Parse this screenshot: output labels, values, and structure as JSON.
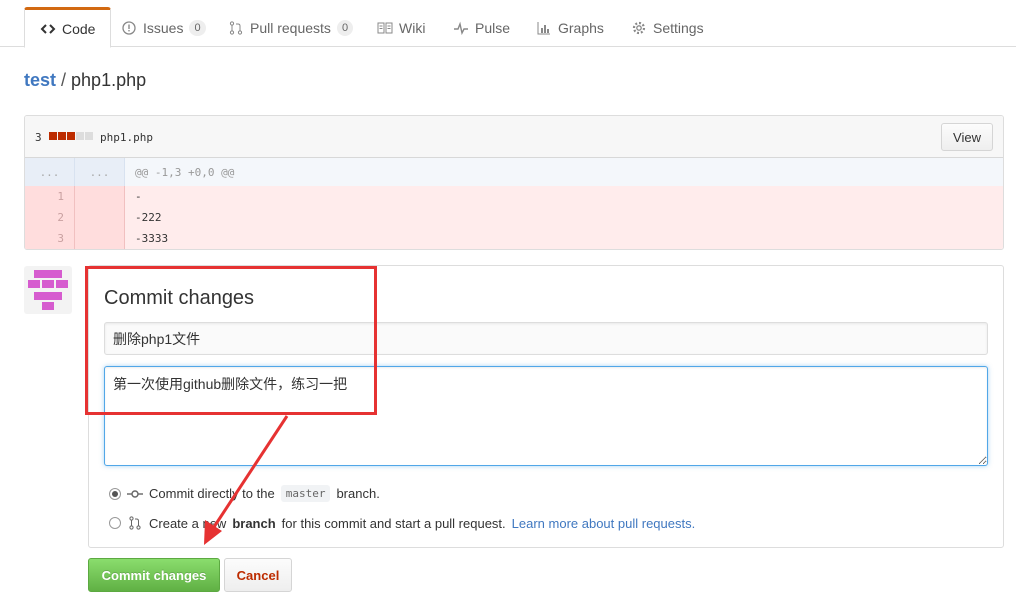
{
  "tabs": [
    {
      "label": "Code",
      "icon": "code-icon"
    },
    {
      "label": "Issues",
      "count": "0",
      "icon": "issue-icon"
    },
    {
      "label": "Pull requests",
      "count": "0",
      "icon": "pull-request-icon"
    },
    {
      "label": "Wiki",
      "icon": "book-icon"
    },
    {
      "label": "Pulse",
      "icon": "pulse-icon"
    },
    {
      "label": "Graphs",
      "icon": "graph-icon"
    },
    {
      "label": "Settings",
      "icon": "gear-icon"
    }
  ],
  "breadcrumb": {
    "repo": "test",
    "separator": "/",
    "file": "php1.php"
  },
  "file": {
    "diffstat": "3",
    "diffstat_colors": [
      "#bd2c00",
      "#bd2c00",
      "#bd2c00",
      "#dddddd",
      "#dddddd"
    ],
    "name": "php1.php",
    "view_label": "View",
    "hunk": {
      "ln_left": "...",
      "ln_right": "...",
      "text": "@@ -1,3 +0,0 @@"
    },
    "lines": [
      {
        "ln": "1",
        "text": "-"
      },
      {
        "ln": "2",
        "text": "-222"
      },
      {
        "ln": "3",
        "text": "-3333"
      }
    ]
  },
  "commit": {
    "title": "Commit changes",
    "summary_value": "删除php1文件",
    "description_value": "第一次使用github删除文件，练习一把",
    "option_direct": {
      "prefix": "Commit directly to the",
      "branch": "master",
      "suffix": "branch."
    },
    "option_new": {
      "prefix": "Create a new",
      "bold": "branch",
      "suffix": "for this commit and start a pull request.",
      "link": "Learn more about pull requests."
    },
    "submit_label": "Commit changes",
    "cancel_label": "Cancel"
  },
  "colors": {
    "accent": "#4078c0",
    "annotation": "#e63232",
    "submit": "#60b044",
    "deleted": "#ffecec"
  }
}
